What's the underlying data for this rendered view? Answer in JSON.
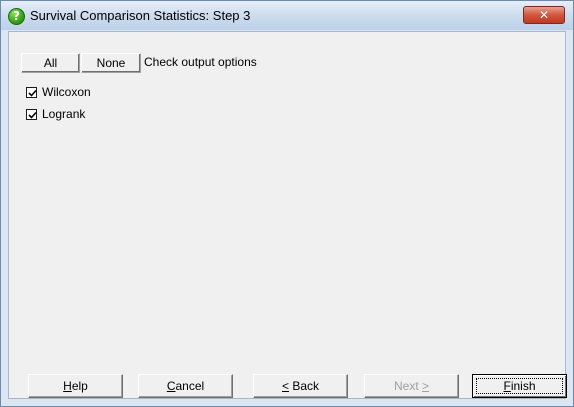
{
  "window": {
    "title": "Survival Comparison Statistics: Step 3",
    "close_icon": "close-icon"
  },
  "toolbar": {
    "all_label": "All",
    "none_label": "None",
    "instruction": "Check output options"
  },
  "options": [
    {
      "label": "Wilcoxon",
      "checked": true
    },
    {
      "label": "Logrank",
      "checked": true
    }
  ],
  "buttons": {
    "help": {
      "mnemonic": "H",
      "rest": "elp"
    },
    "cancel": {
      "mnemonic": "C",
      "rest": "ancel"
    },
    "back": {
      "mnemonic": "<",
      "rest": " Back"
    },
    "next": {
      "text": "Next ",
      "mnemonic": ">"
    },
    "finish": {
      "mnemonic": "F",
      "rest": "inish"
    }
  }
}
